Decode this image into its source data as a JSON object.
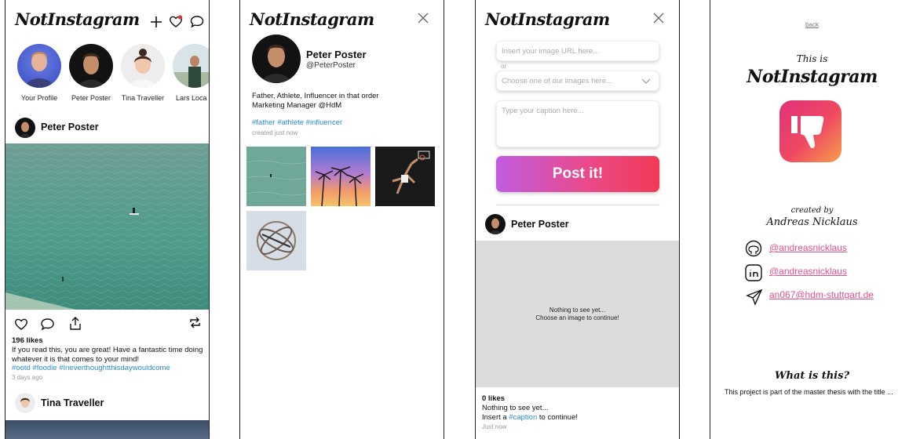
{
  "app": {
    "logo": "NotInstagram"
  },
  "feed": {
    "stories": [
      {
        "label": "Your Profile"
      },
      {
        "label": "Peter Poster"
      },
      {
        "label": "Tina Traveller"
      },
      {
        "label": "Lars Loca"
      }
    ],
    "post1": {
      "author": "Peter Poster",
      "likes": "196 likes",
      "caption": "If you read this, you are great! Have a fantastic time doing whatever it is that comes to your mind!",
      "hashtags": "#ootd #foodie #Ineverthoughtthisdaywouldcome",
      "time": "3 days ago"
    },
    "post2": {
      "author": "Tina Traveller"
    }
  },
  "profile": {
    "name": "Peter Poster",
    "handle": "@PeterPoster",
    "bio_line1": "Father, Athlete, Influencer in that order",
    "bio_line2": "Marketing Manager @HdM",
    "hashtags": "#father #athlete #influencer",
    "created": "created just now"
  },
  "create": {
    "url_placeholder": "Insert your image URL here...",
    "or_text": "or",
    "choose_placeholder": "Choose one of our images here...",
    "caption_placeholder": "Type your caption here...",
    "post_button": "Post it!",
    "preview_author": "Peter Poster",
    "empty_line1": "Nothing to see yet...",
    "empty_line2": "Choose an image to continue!",
    "likes": "0 likes",
    "caption_line1": "Nothing to see yet...",
    "caption_pre": "Insert a ",
    "caption_tag": "#caption",
    "caption_post": " to continue!",
    "time": "Just now"
  },
  "about": {
    "back": "back",
    "this_is": "This is",
    "logo": "NotInstagram",
    "created_by": "created by",
    "author": "Andreas Nicklaus",
    "github": "@andreasnicklaus",
    "linkedin": "@andreasnicklaus",
    "email": "an067@hdm-stuttgart.de",
    "what_title": "What is this?",
    "what_text": "This project is part of the master thesis with the title ..."
  },
  "colors": {
    "accent": "#2a8bd1",
    "pink": "#e2508a",
    "gradient_start": "#c05ce0",
    "gradient_end": "#f23a56"
  }
}
